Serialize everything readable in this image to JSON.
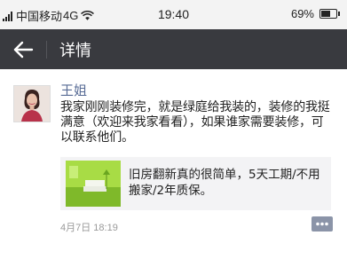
{
  "status_bar": {
    "carrier": "中国移动",
    "network": "4G",
    "time": "19:40",
    "battery": "69%",
    "battery_level": 0.69
  },
  "header": {
    "title": "详情",
    "back_icon": "arrow-left-icon"
  },
  "post": {
    "username": "王姐",
    "content": "我家刚刚装修完，就是绿庭给我装的，装修的我挺满意（欢迎来我家看看），如果谁家需要装修，可以联系他们。",
    "link": {
      "text": "旧房翻新真的很简单，5天工期/不用搬家/2年质保。"
    },
    "timestamp": "4月7日 18:19",
    "comment_icon": "comment-dots-icon"
  },
  "colors": {
    "header_bg": "#393a3f",
    "username": "#576b95",
    "link_card_bg": "#f3f3f5",
    "timestamp": "#9a9a9a",
    "comment_icon": "#8b94a8"
  }
}
